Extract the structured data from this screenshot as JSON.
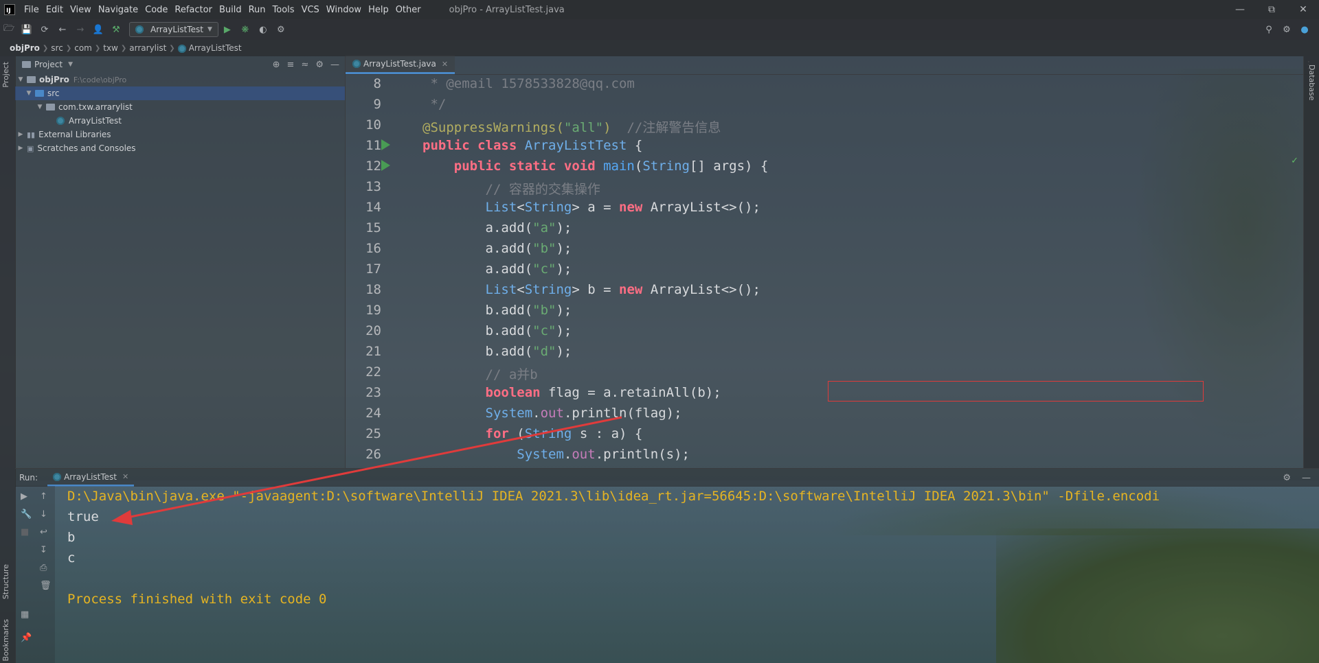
{
  "menubar": {
    "items": [
      "File",
      "Edit",
      "View",
      "Navigate",
      "Code",
      "Refactor",
      "Build",
      "Run",
      "Tools",
      "VCS",
      "Window",
      "Help",
      "Other"
    ],
    "window_title": "objPro - ArrayListTest.java"
  },
  "toolbar": {
    "run_config": "ArrayListTest"
  },
  "breadcrumb": [
    "objPro",
    "src",
    "com",
    "txw",
    "arrarylist",
    "ArrayListTest"
  ],
  "left_strip": {
    "project_tab": "Project",
    "structure_tab": "Structure",
    "bookmarks_tab": "Bookmarks"
  },
  "project_panel": {
    "title": "Project",
    "tree": {
      "root": "objPro",
      "root_path": "F:\\code\\objPro",
      "src": "src",
      "package": "com.txw.arrarylist",
      "file": "ArrayListTest",
      "external": "External Libraries",
      "scratches": "Scratches and Consoles"
    }
  },
  "editor": {
    "tab": "ArrayListTest.java",
    "lines": [
      {
        "n": "8"
      },
      {
        "n": "9"
      },
      {
        "n": "10"
      },
      {
        "n": "11"
      },
      {
        "n": "12"
      },
      {
        "n": "13"
      },
      {
        "n": "14"
      },
      {
        "n": "15"
      },
      {
        "n": "16"
      },
      {
        "n": "17"
      },
      {
        "n": "18"
      },
      {
        "n": "19"
      },
      {
        "n": "20"
      },
      {
        "n": "21"
      },
      {
        "n": "22"
      },
      {
        "n": "23"
      },
      {
        "n": "24"
      },
      {
        "n": "25"
      },
      {
        "n": "26"
      }
    ],
    "code": {
      "l8_a": " * @email ",
      "l8_b": "1578533828@qq.com",
      "l9": " */",
      "l10_ann": "@SuppressWarnings(",
      "l10_str": "\"all\"",
      "l10_close": ")  ",
      "l10_cmt": "//注解警告信息",
      "l11_kw": "public class ",
      "l11_cls": "ArrayListTest",
      "l11_rest": " {",
      "l12_kw": "    public static void ",
      "l12_fn": "main",
      "l12_p": "(",
      "l12_typ": "String",
      "l12_rest": "[] args) {",
      "l13": "        // 容器的交集操作",
      "l14_t": "        List",
      "l14_lt": "<",
      "l14_typ": "String",
      "l14_a": "> a = ",
      "l14_new": "new",
      "l14_rest": " ArrayList<>();",
      "l15_a": "        a.add(",
      "l15_s": "\"a\"",
      "l15_e": ");",
      "l16_a": "        a.add(",
      "l16_s": "\"b\"",
      "l16_e": ");",
      "l17_a": "        a.add(",
      "l17_s": "\"c\"",
      "l17_e": ");",
      "l18_t": "        List",
      "l18_lt": "<",
      "l18_typ": "String",
      "l18_a": "> b = ",
      "l18_new": "new",
      "l18_rest": " ArrayList<>();",
      "l19_a": "        b.add(",
      "l19_s": "\"b\"",
      "l19_e": ");",
      "l20_a": "        b.add(",
      "l20_s": "\"c\"",
      "l20_e": ");",
      "l21_a": "        b.add(",
      "l21_s": "\"d\"",
      "l21_e": ");",
      "l22": "        // a并b",
      "l23_kw": "        boolean",
      "l23_rest": " flag = a.retainAll(b);",
      "l24_sys": "        System",
      "l24_dot": ".",
      "l24_out": "out",
      "l24_rest": ".println(flag);",
      "l25_for": "        for",
      "l25_p": " (",
      "l25_typ": "String",
      "l25_rest": " s : a) {",
      "l26_sys": "            System",
      "l26_dot": ".",
      "l26_out": "out",
      "l26_rest": ".println(s);"
    }
  },
  "right_strip": {
    "database_tab": "Database"
  },
  "run_panel": {
    "label": "Run:",
    "tab": "ArrayListTest",
    "output": [
      "D:\\Java\\bin\\java.exe \"-javaagent:D:\\software\\IntelliJ IDEA 2021.3\\lib\\idea_rt.jar=56645:D:\\software\\IntelliJ IDEA 2021.3\\bin\" -Dfile.encodi",
      "true",
      "b",
      "c",
      "",
      "Process finished with exit code 0"
    ]
  },
  "colors": {
    "annotation_box": "#e03b3b",
    "arrow": "#e03b3b",
    "keyword": "#ff6e84",
    "type": "#6fafea",
    "string": "#6aab73",
    "console_yellow": "#e6b422"
  },
  "icons": {
    "run": "play-icon",
    "debug": "bug-icon",
    "search": "search-icon",
    "settings": "gear-icon"
  }
}
